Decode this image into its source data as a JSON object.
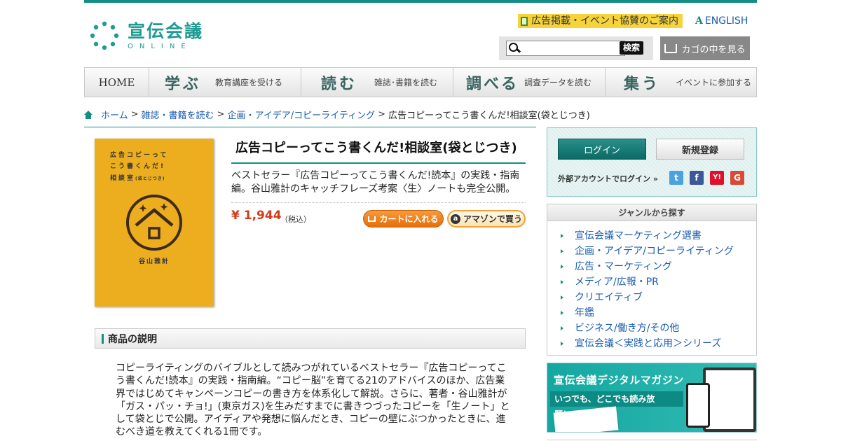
{
  "header": {
    "logo_title": "宣伝会議",
    "logo_sub": "ONLINE",
    "ad_link": "広告掲載・イベント協賛のご案内",
    "english": "ENGLISH",
    "search_placeholder": "",
    "search_button": "検索",
    "cart_button": "カゴの中を見る"
  },
  "nav": {
    "home": "HOME",
    "items": [
      {
        "big": "学ぶ",
        "small": "教育講座を受ける"
      },
      {
        "big": "読む",
        "small": "雑誌･書籍を読む"
      },
      {
        "big": "調べる",
        "small": "調査データを読む"
      },
      {
        "big": "集う",
        "small": "イベントに参加する"
      }
    ]
  },
  "breadcrumb": {
    "home": "ホーム",
    "level1": "雑誌・書籍を読む",
    "level2": "企画・アイデア/コピーライティング",
    "current": "広告コピーってこう書くんだ!相談室(袋とじつき)"
  },
  "book_cover": {
    "line1": "広告コピーって",
    "line2": "こう書くんだ!",
    "line3": "相談室",
    "line3_small": "(袋とじつき)",
    "author": "谷山雅計"
  },
  "product": {
    "title": "広告コピーってこう書くんだ!相談室(袋とじつき)",
    "description": "ベストセラー『広告コピーってこう書くんだ!読本』の実践・指南編。谷山雅計のキャッチフレーズ考案〈生〉ノートも完全公開。",
    "price": "¥ 1,944",
    "tax": "（税込）",
    "add_cart": "カートに入れる",
    "amazon": "アマゾンで買う"
  },
  "details": {
    "heading": "商品の説明",
    "text": "コピーライティングのバイブルとして読みつがれているベストセラー『広告コピーってこう書くんだ!読本』の実践・指南編。“コピー脳”を育てる21のアドバイスのほか、広告業界ではじめてキャンペーンコピーの書き方を体系化して解説。さらに、著者・谷山雅計が「ガス・パッ・チョ!」(東京ガス)を生みだすまでに書きつづったコピーを「生ノート」として袋とじで公開。アイディアや発想に悩んだとき、コピーの壁にぶつかったときに、進むべき道を教えてくれる1冊です。"
  },
  "sidebar": {
    "login": "ログイン",
    "register": "新規登録",
    "external_login": "外部アカウントでログイン »",
    "social": [
      {
        "name": "twitter-icon",
        "glyph": "t",
        "color": "#4aa2e0"
      },
      {
        "name": "facebook-icon",
        "glyph": "f",
        "color": "#3b5998"
      },
      {
        "name": "yahoo-icon",
        "glyph": "Y!",
        "color": "#e0102a"
      },
      {
        "name": "google-icon",
        "glyph": "G",
        "color": "#d94a38"
      }
    ],
    "genre_heading": "ジャンルから探す",
    "genres": [
      "宣伝会議マーケティング選書",
      "企画・アイデア/コピーライティング",
      "広告・マーケティング",
      "メディア/広報・PR",
      "クリエイティブ",
      "年鑑",
      "ビジネス/働き方/その他",
      "宣伝会議＜実践と応用＞シリーズ"
    ],
    "banner_title": "宣伝会議デジタルマガジン",
    "banner_sub": "いつでも、どこでも読み放題！！！"
  },
  "colors": {
    "accent": "#138d85",
    "price": "#d43a1b",
    "link": "#1a5db0",
    "book": "#ecae1f"
  }
}
